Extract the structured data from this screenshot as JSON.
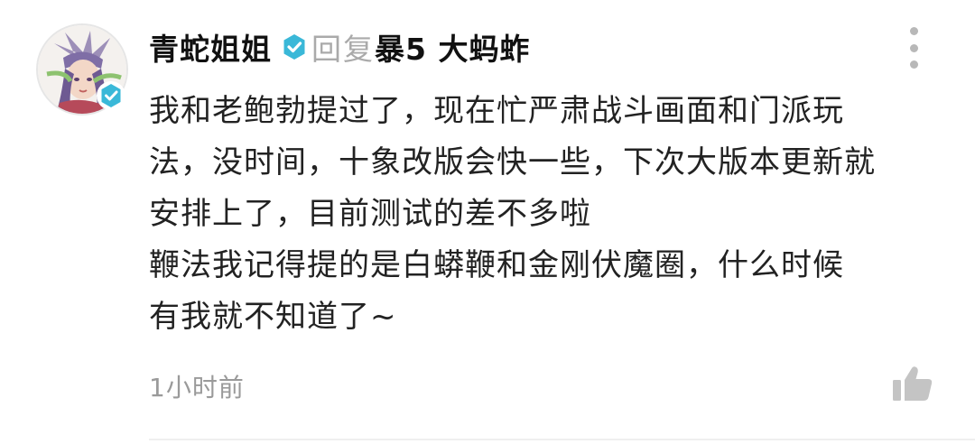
{
  "comment": {
    "username": "青蛇姐姐",
    "reply_word": "回复",
    "reply_target": "暴5  大蚂蚱",
    "text": "我和老鲍勃提过了，现在忙严肃战斗画面和门派玩\n法，没时间，十象改版会快一些，下次大版本更新就\n安排上了，目前测试的差不多啦\n鞭法我记得提的是白蟒鞭和金刚伏魔圈，什么时候\n有我就不知道了~",
    "timestamp": "1小时前"
  },
  "icons": {
    "verified": "verified-badge-icon",
    "more": "more-vertical-icon",
    "like": "thumbs-up-icon"
  },
  "colors": {
    "verified_badge": "#3ab8d8",
    "muted_text": "#9a9a9a",
    "icon_gray": "#c4c4c4"
  }
}
